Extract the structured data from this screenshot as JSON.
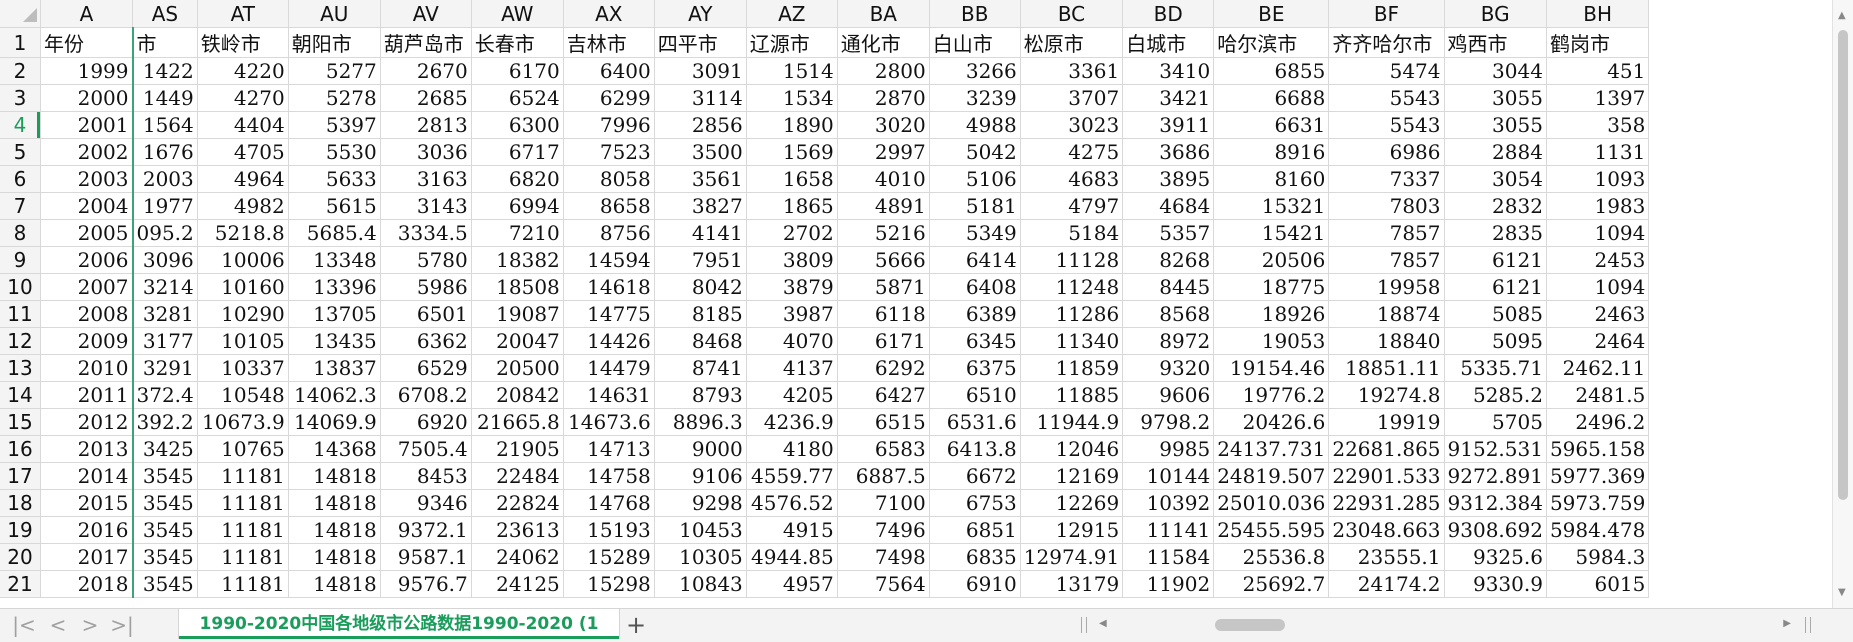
{
  "sheet": {
    "columns": [
      "A",
      "AS",
      "AT",
      "AU",
      "AV",
      "AW",
      "AX",
      "AY",
      "AZ",
      "BA",
      "BB",
      "BC",
      "BD",
      "BE",
      "BF",
      "BG",
      "BH"
    ],
    "rows": [
      {
        "n": "1",
        "cells": [
          "年份",
          "市",
          "铁岭市",
          "朝阳市",
          "葫芦岛市",
          "长春市",
          "吉林市",
          "四平市",
          "辽源市",
          "通化市",
          "白山市",
          "松原市",
          "白城市",
          "哈尔滨市",
          "齐齐哈尔市",
          "鸡西市",
          "鹤岗市"
        ]
      },
      {
        "n": "2",
        "cells": [
          "1999",
          "1422",
          "4220",
          "5277",
          "2670",
          "6170",
          "6400",
          "3091",
          "1514",
          "2800",
          "3266",
          "3361",
          "3410",
          "6855",
          "5474",
          "3044",
          "451"
        ]
      },
      {
        "n": "3",
        "cells": [
          "2000",
          "1449",
          "4270",
          "5278",
          "2685",
          "6524",
          "6299",
          "3114",
          "1534",
          "2870",
          "3239",
          "3707",
          "3421",
          "6688",
          "5543",
          "3055",
          "1397"
        ]
      },
      {
        "n": "4",
        "cells": [
          "2001",
          "1564",
          "4404",
          "5397",
          "2813",
          "6300",
          "7996",
          "2856",
          "1890",
          "3020",
          "4988",
          "3023",
          "3911",
          "6631",
          "5543",
          "3055",
          "358"
        ]
      },
      {
        "n": "5",
        "cells": [
          "2002",
          "1676",
          "4705",
          "5530",
          "3036",
          "6717",
          "7523",
          "3500",
          "1569",
          "2997",
          "5042",
          "4275",
          "3686",
          "8916",
          "6986",
          "2884",
          "1131"
        ]
      },
      {
        "n": "6",
        "cells": [
          "2003",
          "2003",
          "4964",
          "5633",
          "3163",
          "6820",
          "8058",
          "3561",
          "1658",
          "4010",
          "5106",
          "4683",
          "3895",
          "8160",
          "7337",
          "3054",
          "1093"
        ]
      },
      {
        "n": "7",
        "cells": [
          "2004",
          "1977",
          "4982",
          "5615",
          "3143",
          "6994",
          "8658",
          "3827",
          "1865",
          "4891",
          "5181",
          "4797",
          "4684",
          "15321",
          "7803",
          "2832",
          "1983"
        ]
      },
      {
        "n": "8",
        "cells": [
          "2005",
          "095.2",
          "5218.8",
          "5685.4",
          "3334.5",
          "7210",
          "8756",
          "4141",
          "2702",
          "5216",
          "5349",
          "5184",
          "5357",
          "15421",
          "7857",
          "2835",
          "1094"
        ]
      },
      {
        "n": "9",
        "cells": [
          "2006",
          "3096",
          "10006",
          "13348",
          "5780",
          "18382",
          "14594",
          "7951",
          "3809",
          "5666",
          "6414",
          "11128",
          "8268",
          "20506",
          "7857",
          "6121",
          "2453"
        ]
      },
      {
        "n": "10",
        "cells": [
          "2007",
          "3214",
          "10160",
          "13396",
          "5986",
          "18508",
          "14618",
          "8042",
          "3879",
          "5871",
          "6408",
          "11248",
          "8445",
          "18775",
          "19958",
          "6121",
          "1094"
        ]
      },
      {
        "n": "11",
        "cells": [
          "2008",
          "3281",
          "10290",
          "13705",
          "6501",
          "19087",
          "14775",
          "8185",
          "3987",
          "6118",
          "6389",
          "11286",
          "8568",
          "18926",
          "18874",
          "5085",
          "2463"
        ]
      },
      {
        "n": "12",
        "cells": [
          "2009",
          "3177",
          "10105",
          "13435",
          "6362",
          "20047",
          "14426",
          "8468",
          "4070",
          "6171",
          "6345",
          "11340",
          "8972",
          "19053",
          "18840",
          "5095",
          "2464"
        ]
      },
      {
        "n": "13",
        "cells": [
          "2010",
          "3291",
          "10337",
          "13837",
          "6529",
          "20500",
          "14479",
          "8741",
          "4137",
          "6292",
          "6375",
          "11859",
          "9320",
          "19154.46",
          "18851.11",
          "5335.71",
          "2462.11"
        ]
      },
      {
        "n": "14",
        "cells": [
          "2011",
          "372.4",
          "10548",
          "14062.3",
          "6708.2",
          "20842",
          "14631",
          "8793",
          "4205",
          "6427",
          "6510",
          "11885",
          "9606",
          "19776.2",
          "19274.8",
          "5285.2",
          "2481.5"
        ]
      },
      {
        "n": "15",
        "cells": [
          "2012",
          "392.2",
          "10673.9",
          "14069.9",
          "6920",
          "21665.8",
          "14673.6",
          "8896.3",
          "4236.9",
          "6515",
          "6531.6",
          "11944.9",
          "9798.2",
          "20426.6",
          "19919",
          "5705",
          "2496.2"
        ]
      },
      {
        "n": "16",
        "cells": [
          "2013",
          "3425",
          "10765",
          "14368",
          "7505.4",
          "21905",
          "14713",
          "9000",
          "4180",
          "6583",
          "6413.8",
          "12046",
          "9985",
          "24137.731",
          "22681.865",
          "9152.531",
          "5965.158"
        ]
      },
      {
        "n": "17",
        "cells": [
          "2014",
          "3545",
          "11181",
          "14818",
          "8453",
          "22484",
          "14758",
          "9106",
          "4559.77",
          "6887.5",
          "6672",
          "12169",
          "10144",
          "24819.507",
          "22901.533",
          "9272.891",
          "5977.369"
        ]
      },
      {
        "n": "18",
        "cells": [
          "2015",
          "3545",
          "11181",
          "14818",
          "9346",
          "22824",
          "14768",
          "9298",
          "4576.52",
          "7100",
          "6753",
          "12269",
          "10392",
          "25010.036",
          "22931.285",
          "9312.384",
          "5973.759"
        ]
      },
      {
        "n": "19",
        "cells": [
          "2016",
          "3545",
          "11181",
          "14818",
          "9372.1",
          "23613",
          "15193",
          "10453",
          "4915",
          "7496",
          "6851",
          "12915",
          "11141",
          "25455.595",
          "23048.663",
          "9308.692",
          "5984.478"
        ]
      },
      {
        "n": "20",
        "cells": [
          "2017",
          "3545",
          "11181",
          "14818",
          "9587.1",
          "24062",
          "15289",
          "10305",
          "4944.85",
          "7498",
          "6835",
          "12974.91",
          "11584",
          "25536.8",
          "23555.1",
          "9325.6",
          "5984.3"
        ]
      },
      {
        "n": "21",
        "cells": [
          "2018",
          "3545",
          "11181",
          "14818",
          "9576.7",
          "24125",
          "15298",
          "10843",
          "4957",
          "7564",
          "6910",
          "13179",
          "11902",
          "25692.7",
          "24174.2",
          "9330.9",
          "6015"
        ]
      }
    ]
  },
  "tabs": {
    "sheet_name": "1990-2020中国各地级市公路数据1990-2020 (1",
    "add": "+"
  },
  "nav": {
    "first": "|<",
    "prev": "<",
    "next": ">",
    "last": ">|"
  },
  "colors": {
    "accent": "#1a9c5b",
    "header_bg": "#f4f4f4",
    "grid": "#d9d9d9"
  }
}
